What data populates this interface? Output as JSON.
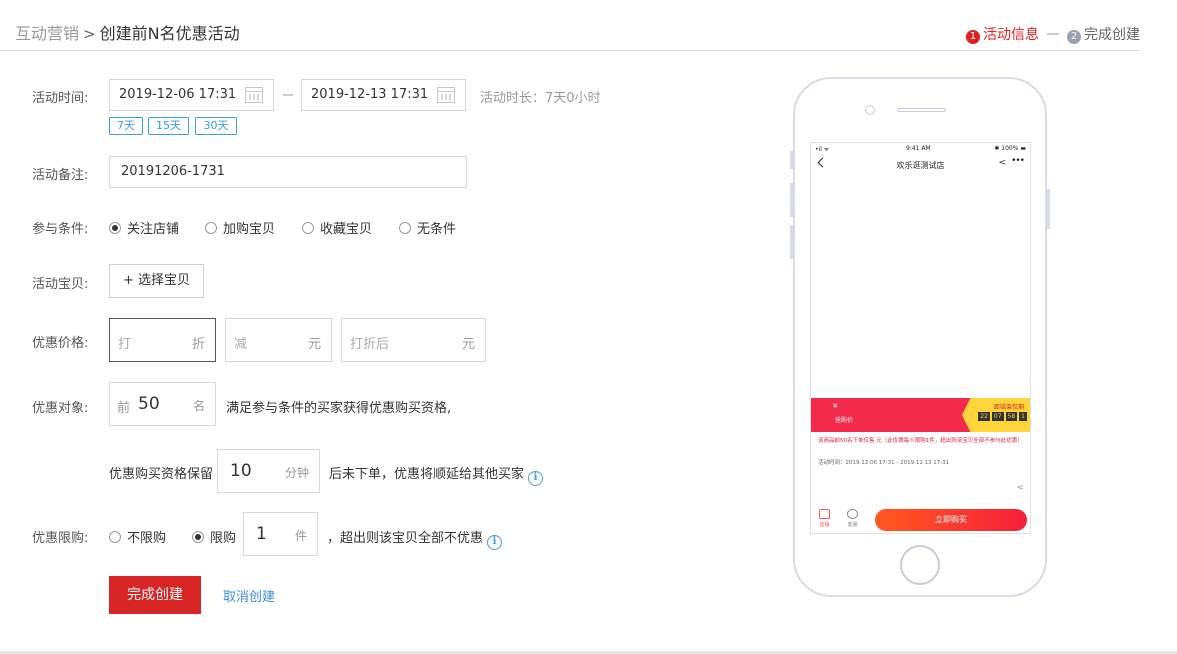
{
  "breadcrumb": {
    "parent": "互动营销",
    "separator": ">",
    "current": "创建前N名优惠活动"
  },
  "steps": [
    {
      "num": "1",
      "label": "活动信息"
    },
    {
      "num": "2",
      "label": "完成创建"
    }
  ],
  "form": {
    "time": {
      "label": "活动时间:",
      "start": "2019-12-06 17:31",
      "end": "2019-12-13 17:31",
      "duration": "活动时长：7天0小时",
      "quick": [
        "7天",
        "15天",
        "30天"
      ]
    },
    "remark": {
      "label": "活动备注:",
      "value": "20191206-1731"
    },
    "condition": {
      "label": "参与条件:",
      "options": [
        "关注店铺",
        "加购宝贝",
        "收藏宝贝",
        "无条件"
      ],
      "selected_index": 0
    },
    "items": {
      "label": "活动宝贝:",
      "button": "+ 选择宝贝"
    },
    "price": {
      "label": "优惠价格:",
      "discount": {
        "placeholder": "打",
        "unit": "折"
      },
      "minus": {
        "placeholder": "减",
        "unit": "元"
      },
      "after": {
        "placeholder": "打折后",
        "unit": "元"
      }
    },
    "target": {
      "label": "优惠对象:",
      "prefix": "前",
      "value": "50",
      "unit": "名",
      "desc": "满足参与条件的买家获得优惠购买资格,"
    },
    "reserve": {
      "pre": "优惠购买资格保留",
      "value": "10",
      "unit": "分钟",
      "post": "后未下单，优惠将顺延给其他买家"
    },
    "limit": {
      "label": "优惠限购:",
      "option_none": "不限购",
      "option_limit": "限购",
      "selected": "限购",
      "value": "1",
      "unit": "件",
      "post": "，超出则该宝贝全部不优惠"
    },
    "submit": "完成创建",
    "cancel": "取消创建"
  },
  "phone": {
    "status_time": "9:41 AM",
    "status_signal": "•ıl ᯤ",
    "status_battery": "✱ 100% ▬",
    "shop_title": "欢乐逛测试店",
    "promo_yen": "¥",
    "promo_tag": "抢购价",
    "promo_right_title": "距结束仅剩",
    "countdown": [
      "22",
      "07",
      "58",
      "1"
    ],
    "desc": "该商品前50名下单仅售 元（此优惠每人限购1件，超出则该宝贝全部不参与此优惠）",
    "desc_time": "活动时间：2019.12.06 17:31 - 2019.12.13 17:31",
    "tab_store": "店铺",
    "tab_service": "客服",
    "buy": "立即购买"
  }
}
